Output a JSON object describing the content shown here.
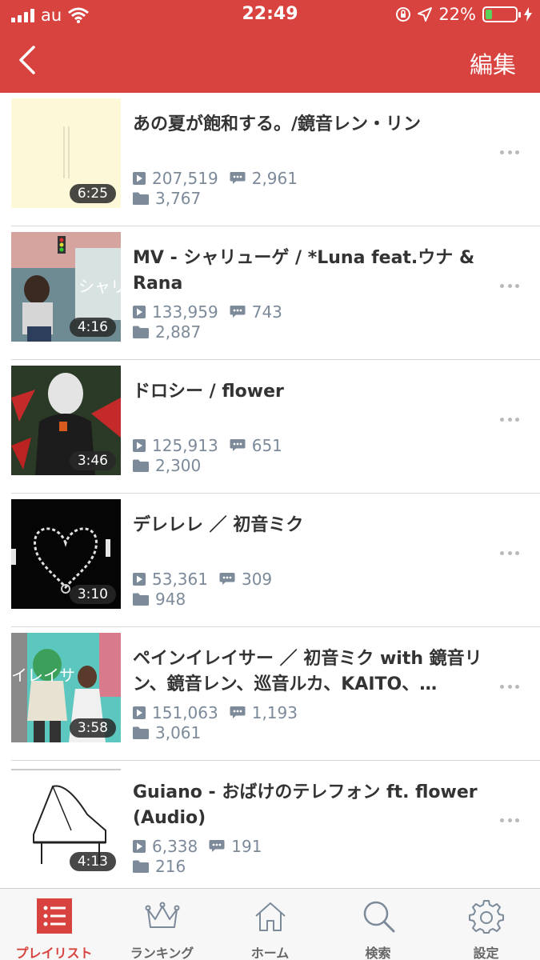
{
  "status_bar": {
    "carrier": "au",
    "time": "22:49",
    "battery": "22%",
    "battery_level": 0.22
  },
  "nav": {
    "back_icon": "chevron-left-icon",
    "edit_label": "編集"
  },
  "items": [
    {
      "title": "あの夏が飽和する。/鏡音レン・リン",
      "duration": "6:25",
      "views": "207,519",
      "comments": "2,961",
      "mylists": "3,767"
    },
    {
      "title": "MV - シャリューゲ / *Luna feat.ウナ & Rana",
      "duration": "4:16",
      "views": "133,959",
      "comments": "743",
      "mylists": "2,887"
    },
    {
      "title": "ドロシー / flower",
      "duration": "3:46",
      "views": "125,913",
      "comments": "651",
      "mylists": "2,300"
    },
    {
      "title": "デレレレ ／ 初音ミク",
      "duration": "3:10",
      "views": "53,361",
      "comments": "309",
      "mylists": "948"
    },
    {
      "title": "ペインイレイサー ／ 初音ミク with 鏡音リン、鏡音レン、巡音ルカ、KAITO、…",
      "duration": "3:58",
      "views": "151,063",
      "comments": "1,193",
      "mylists": "3,061"
    },
    {
      "title": "Guiano - おばけのテレフォン ft. flower (Audio)",
      "duration": "4:13",
      "views": "6,338",
      "comments": "191",
      "mylists": "216"
    }
  ],
  "tabs": [
    {
      "label": "プレイリスト",
      "icon": "playlist-icon",
      "active": true
    },
    {
      "label": "ランキング",
      "icon": "crown-icon",
      "active": false
    },
    {
      "label": "ホーム",
      "icon": "home-icon",
      "active": false
    },
    {
      "label": "検索",
      "icon": "search-icon",
      "active": false
    },
    {
      "label": "設定",
      "icon": "gear-icon",
      "active": false
    }
  ],
  "colors": {
    "brand": "#d9433f",
    "stat": "#7c8a99"
  }
}
